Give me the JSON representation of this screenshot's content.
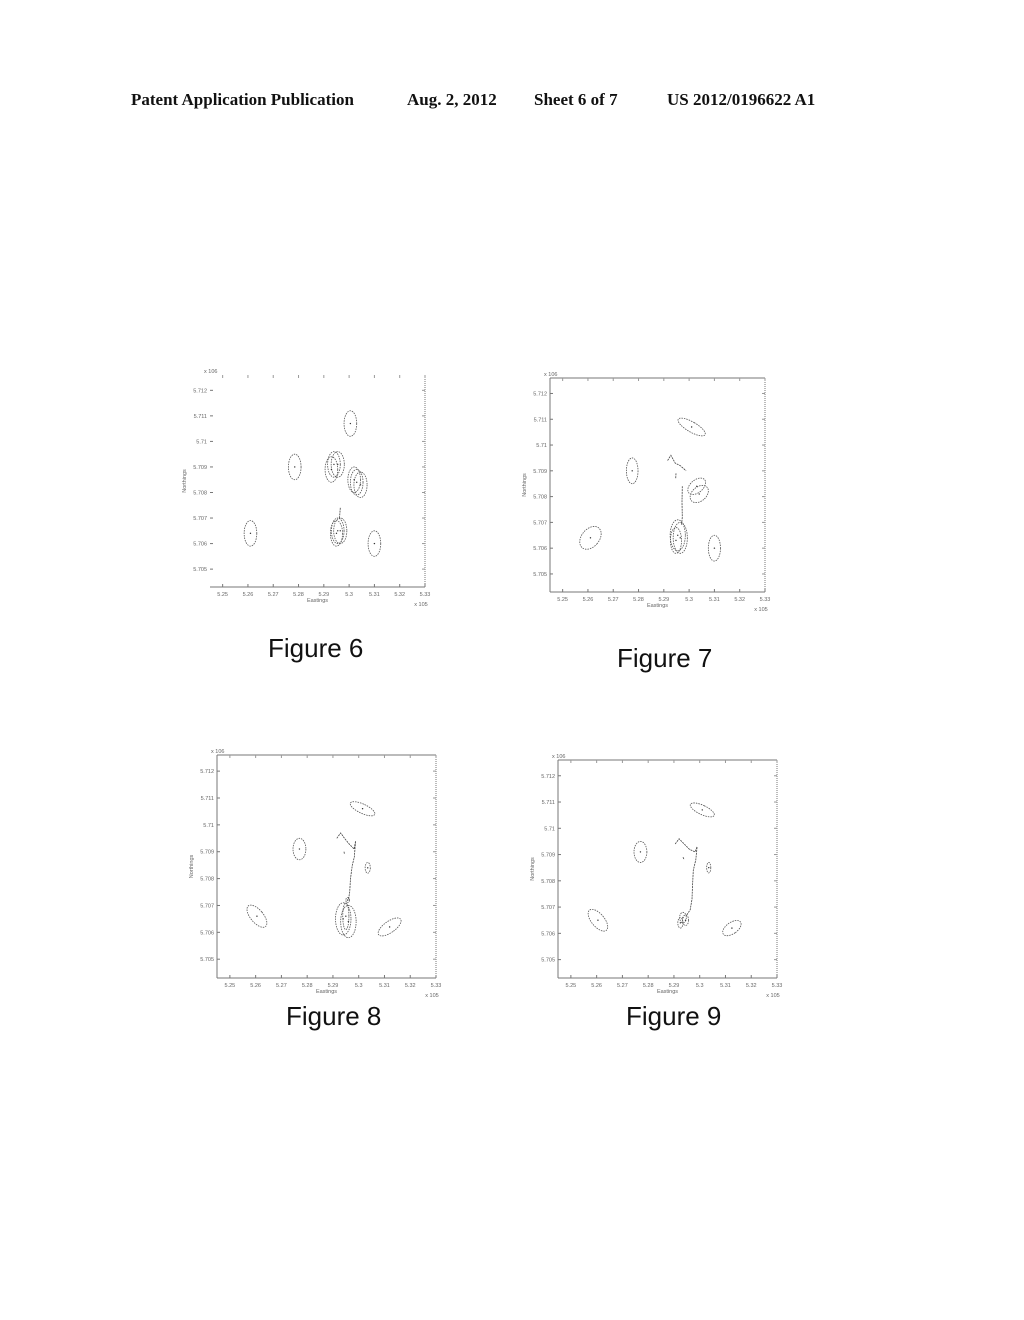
{
  "header": {
    "publication": "Patent Application Publication",
    "date": "Aug. 2, 2012",
    "sheet": "Sheet 6 of 7",
    "number": "US 2012/0196622 A1"
  },
  "figures": [
    {
      "label": "Figure 6"
    },
    {
      "label": "Figure 7"
    },
    {
      "label": "Figure 8"
    },
    {
      "label": "Figure 9"
    }
  ],
  "chart_data": [
    {
      "type": "scatter",
      "title": "Figure 6",
      "xlabel": "Eastings",
      "ylabel": "Northings",
      "x_multiplier": "x 10^5",
      "y_multiplier": "x 10^6",
      "xlim": [
        5.245,
        5.33
      ],
      "ylim": [
        5.7043,
        5.7126
      ],
      "xticks": [
        "5.25",
        "5.26",
        "5.27",
        "5.28",
        "5.29",
        "5.3",
        "5.31",
        "5.32",
        "5.33"
      ],
      "yticks": [
        "5.705",
        "5.706",
        "5.707",
        "5.708",
        "5.709",
        "5.71",
        "5.711",
        "5.712"
      ],
      "grid": false,
      "ellipses": [
        {
          "x": 5.3005,
          "y": 5.7107,
          "rx": 0.0025,
          "ry": 0.0005,
          "tilt": 0
        },
        {
          "x": 5.2785,
          "y": 5.709,
          "rx": 0.0025,
          "ry": 0.0005,
          "tilt": 0
        },
        {
          "x": 5.294,
          "y": 5.7091,
          "rx": 0.0025,
          "ry": 0.0005,
          "tilt": 0
        },
        {
          "x": 5.2955,
          "y": 5.7091,
          "rx": 0.0026,
          "ry": 0.0005,
          "tilt": 0
        },
        {
          "x": 5.293,
          "y": 5.7089,
          "rx": 0.0025,
          "ry": 0.0005,
          "tilt": 0
        },
        {
          "x": 5.303,
          "y": 5.7084,
          "rx": 0.0025,
          "ry": 0.0005,
          "tilt": 0
        },
        {
          "x": 5.3045,
          "y": 5.7083,
          "rx": 0.0026,
          "ry": 0.0005,
          "tilt": 0
        },
        {
          "x": 5.302,
          "y": 5.7085,
          "rx": 0.0025,
          "ry": 0.0005,
          "tilt": 0
        },
        {
          "x": 5.261,
          "y": 5.7064,
          "rx": 0.0025,
          "ry": 0.0005,
          "tilt": 0
        },
        {
          "x": 5.2955,
          "y": 5.7065,
          "rx": 0.0025,
          "ry": 0.0005,
          "tilt": 0
        },
        {
          "x": 5.2965,
          "y": 5.7065,
          "rx": 0.0026,
          "ry": 0.0005,
          "tilt": 0
        },
        {
          "x": 5.295,
          "y": 5.7064,
          "rx": 0.0024,
          "ry": 0.0005,
          "tilt": 0
        },
        {
          "x": 5.31,
          "y": 5.706,
          "rx": 0.0025,
          "ry": 0.0005,
          "tilt": 0
        }
      ],
      "tracks": [
        [
          [
            5.2965,
            5.7074
          ],
          [
            5.2962,
            5.707
          ]
        ]
      ]
    },
    {
      "type": "scatter",
      "title": "Figure 7",
      "xlabel": "Eastings",
      "ylabel": "Northings",
      "x_multiplier": "x 10^5",
      "y_multiplier": "x 10^6",
      "xlim": [
        5.245,
        5.33
      ],
      "ylim": [
        5.7043,
        5.7126
      ],
      "xticks": [
        "5.25",
        "5.26",
        "5.27",
        "5.28",
        "5.29",
        "5.3",
        "5.31",
        "5.32",
        "5.33"
      ],
      "yticks": [
        "5.705",
        "5.706",
        "5.707",
        "5.708",
        "5.709",
        "5.71",
        "5.711",
        "5.712"
      ],
      "grid": false,
      "ellipses": [
        {
          "x": 5.301,
          "y": 5.7107,
          "rx": 0.002,
          "ry": 0.0006,
          "tilt": -60
        },
        {
          "x": 5.2775,
          "y": 5.709,
          "rx": 0.0023,
          "ry": 0.0005,
          "tilt": 0
        },
        {
          "x": 5.303,
          "y": 5.7084,
          "rx": 0.0025,
          "ry": 0.0004,
          "tilt": 50
        },
        {
          "x": 5.304,
          "y": 5.7081,
          "rx": 0.0028,
          "ry": 0.0004,
          "tilt": 50
        },
        {
          "x": 5.261,
          "y": 5.7064,
          "rx": 0.0035,
          "ry": 0.0005,
          "tilt": 40
        },
        {
          "x": 5.2955,
          "y": 5.7065,
          "rx": 0.003,
          "ry": 0.0006,
          "tilt": 0
        },
        {
          "x": 5.2965,
          "y": 5.7064,
          "rx": 0.0028,
          "ry": 0.0006,
          "tilt": 0
        },
        {
          "x": 5.2948,
          "y": 5.7063,
          "rx": 0.0022,
          "ry": 0.0005,
          "tilt": 0
        },
        {
          "x": 5.31,
          "y": 5.706,
          "rx": 0.0024,
          "ry": 0.0005,
          "tilt": 0
        }
      ],
      "tracks": [
        [
          [
            5.2915,
            5.7094
          ],
          [
            5.2928,
            5.7096
          ],
          [
            5.2945,
            5.7093
          ],
          [
            5.2965,
            5.7092
          ],
          [
            5.2988,
            5.709
          ]
        ],
        [
          [
            5.2948,
            5.7089
          ],
          [
            5.2947,
            5.7087
          ]
        ],
        [
          [
            5.2973,
            5.7084
          ],
          [
            5.2972,
            5.7078
          ],
          [
            5.2973,
            5.7072
          ],
          [
            5.297,
            5.7069
          ]
        ]
      ]
    },
    {
      "type": "scatter",
      "title": "Figure 8",
      "xlabel": "Eastings",
      "ylabel": "Northings",
      "x_multiplier": "x 10^5",
      "y_multiplier": "x 10^6",
      "xlim": [
        5.245,
        5.33
      ],
      "ylim": [
        5.7043,
        5.7126
      ],
      "xticks": [
        "5.25",
        "5.26",
        "5.27",
        "5.28",
        "5.29",
        "5.3",
        "5.31",
        "5.32",
        "5.33"
      ],
      "yticks": [
        "5.705",
        "5.706",
        "5.707",
        "5.708",
        "5.709",
        "5.71",
        "5.711",
        "5.712"
      ],
      "grid": false,
      "ellipses": [
        {
          "x": 5.3015,
          "y": 5.7106,
          "rx": 0.0018,
          "ry": 0.0005,
          "tilt": -65
        },
        {
          "x": 5.277,
          "y": 5.7091,
          "rx": 0.0025,
          "ry": 0.0004,
          "tilt": 0
        },
        {
          "x": 5.3035,
          "y": 5.7084,
          "rx": 0.001,
          "ry": 0.0002,
          "tilt": 0
        },
        {
          "x": 5.2605,
          "y": 5.7066,
          "rx": 0.0025,
          "ry": 0.0005,
          "tilt": -40
        },
        {
          "x": 5.294,
          "y": 5.7065,
          "rx": 0.003,
          "ry": 0.0006,
          "tilt": 0
        },
        {
          "x": 5.296,
          "y": 5.7064,
          "rx": 0.003,
          "ry": 0.0006,
          "tilt": 0
        },
        {
          "x": 5.295,
          "y": 5.7066,
          "rx": 0.0012,
          "ry": 0.0005,
          "tilt": 0
        },
        {
          "x": 5.312,
          "y": 5.7062,
          "rx": 0.0022,
          "ry": 0.0005,
          "tilt": 55
        },
        {
          "x": 5.2957,
          "y": 5.7072,
          "rx": 0.0007,
          "ry": 0.0001,
          "tilt": 0
        }
      ],
      "tracks": [
        [
          [
            5.2915,
            5.7095
          ],
          [
            5.293,
            5.7097
          ],
          [
            5.2945,
            5.7095
          ],
          [
            5.2962,
            5.7093
          ],
          [
            5.2982,
            5.7091
          ],
          [
            5.2988,
            5.7094
          ],
          [
            5.2983,
            5.7088
          ],
          [
            5.2975,
            5.7085
          ],
          [
            5.2968,
            5.708
          ],
          [
            5.2965,
            5.7075
          ],
          [
            5.296,
            5.7072
          ]
        ],
        [
          [
            5.2943,
            5.709
          ],
          [
            5.2945,
            5.7089
          ]
        ]
      ]
    },
    {
      "type": "scatter",
      "title": "Figure 9",
      "xlabel": "Eastings",
      "ylabel": "Northings",
      "x_multiplier": "x 10^5",
      "y_multiplier": "x 10^6",
      "xlim": [
        5.245,
        5.33
      ],
      "ylim": [
        5.7043,
        5.7126
      ],
      "xticks": [
        "5.25",
        "5.26",
        "5.27",
        "5.28",
        "5.29",
        "5.3",
        "5.31",
        "5.32",
        "5.33"
      ],
      "yticks": [
        "5.705",
        "5.706",
        "5.707",
        "5.708",
        "5.709",
        "5.71",
        "5.711",
        "5.712"
      ],
      "grid": false,
      "ellipses": [
        {
          "x": 5.301,
          "y": 5.7107,
          "rx": 0.0018,
          "ry": 0.0005,
          "tilt": -65
        },
        {
          "x": 5.277,
          "y": 5.7091,
          "rx": 0.0025,
          "ry": 0.0004,
          "tilt": 0
        },
        {
          "x": 5.3035,
          "y": 5.7085,
          "rx": 0.0008,
          "ry": 0.0002,
          "tilt": 0
        },
        {
          "x": 5.2605,
          "y": 5.7065,
          "rx": 0.0025,
          "ry": 0.0005,
          "tilt": -40
        },
        {
          "x": 5.2935,
          "y": 5.7066,
          "rx": 0.0013,
          "ry": 0.0002,
          "tilt": 0
        },
        {
          "x": 5.2945,
          "y": 5.7065,
          "rx": 0.0012,
          "ry": 0.0002,
          "tilt": 0
        },
        {
          "x": 5.2925,
          "y": 5.7064,
          "rx": 0.001,
          "ry": 0.0002,
          "tilt": 0
        },
        {
          "x": 5.3125,
          "y": 5.7062,
          "rx": 0.0022,
          "ry": 0.0004,
          "tilt": 55
        }
      ],
      "tracks": [
        [
          [
            5.2905,
            5.7094
          ],
          [
            5.292,
            5.7096
          ],
          [
            5.294,
            5.7094
          ],
          [
            5.296,
            5.7092
          ],
          [
            5.2982,
            5.7091
          ],
          [
            5.299,
            5.7093
          ],
          [
            5.2985,
            5.7088
          ],
          [
            5.2975,
            5.7084
          ],
          [
            5.2972,
            5.7078
          ],
          [
            5.297,
            5.7073
          ],
          [
            5.2963,
            5.7069
          ],
          [
            5.295,
            5.7067
          ]
        ],
        [
          [
            5.2935,
            5.7089
          ],
          [
            5.294,
            5.7088
          ]
        ]
      ]
    }
  ]
}
